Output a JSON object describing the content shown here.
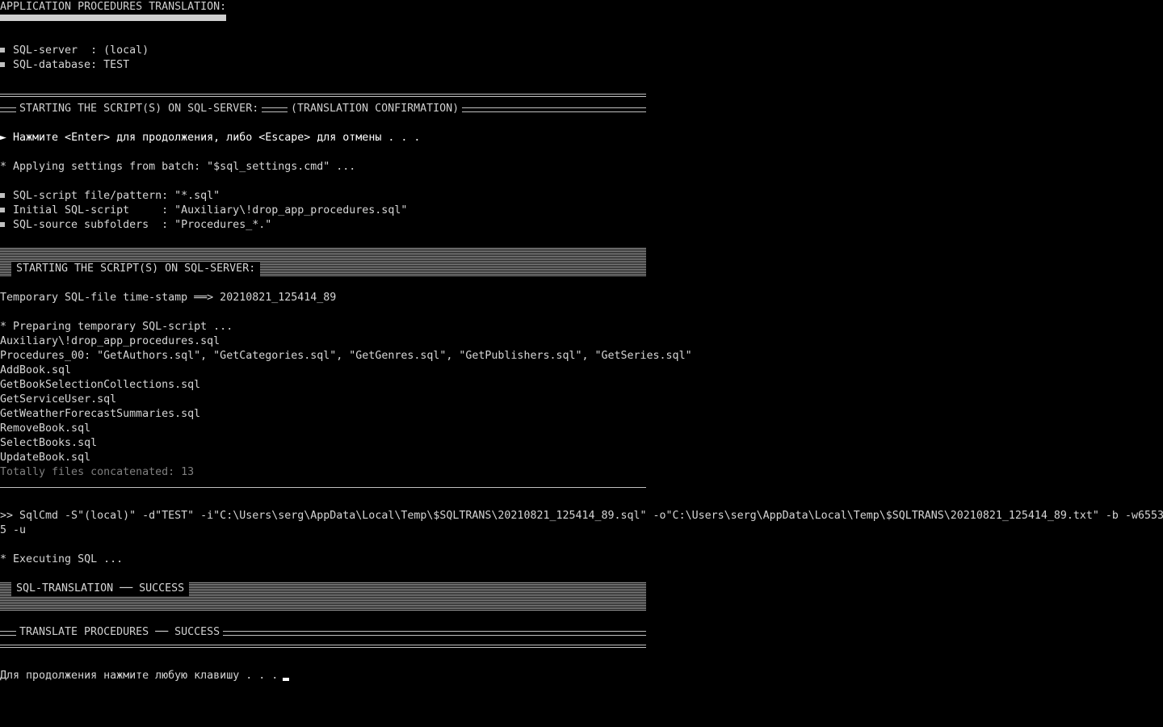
{
  "header": {
    "title": "APPLICATION PROCEDURES TRANSLATION:"
  },
  "server_info": {
    "server_line": "SQL-server  : (local)",
    "database_line": "SQL-database: TEST"
  },
  "confirm_banner": {
    "left": "STARTING THE SCRIPT(S) ON SQL-SERVER:",
    "right": "(TRANSLATION CONFIRMATION)"
  },
  "prompt": {
    "arrow": "►",
    "text": "Нажмите <Enter> для продолжения, либо <Escape> для отмены . . ."
  },
  "applying": "* Applying settings from batch: \"$sql_settings.cmd\" ...",
  "settings": {
    "pattern": "SQL-script file/pattern: \"*.sql\"",
    "initial": "Initial SQL-script     : \"Auxiliary\\!drop_app_procedures.sql\"",
    "subfolders": "SQL-source subfolders  : \"Procedures_*.\""
  },
  "run_banner": {
    "label": "STARTING THE SCRIPT(S) ON SQL-SERVER:"
  },
  "timestamp_line": "Temporary SQL-file time-stamp ══> 20210821_125414_89",
  "preparing": "* Preparing temporary SQL-script ...",
  "files": [
    "Auxiliary\\!drop_app_procedures.sql",
    "Procedures_00: \"GetAuthors.sql\", \"GetCategories.sql\", \"GetGenres.sql\", \"GetPublishers.sql\", \"GetSeries.sql\"",
    "AddBook.sql",
    "GetBookSelectionCollections.sql",
    "GetServiceUser.sql",
    "GetWeatherForecastSummaries.sql",
    "RemoveBook.sql",
    "SelectBooks.sql",
    "UpdateBook.sql"
  ],
  "total": "Totally files concatenated: 13",
  "command": {
    "line1": ">> SqlCmd -S\"(local)\" -d\"TEST\" -i\"C:\\Users\\serg\\AppData\\Local\\Temp\\$SQLTRANS\\20210821_125414_89.sql\" -o\"C:\\Users\\serg\\AppData\\Local\\Temp\\$SQLTRANS\\20210821_125414_89.txt\" -b -w6553",
    "line2": "5 -u"
  },
  "executing": "* Executing SQL ...",
  "translation_banner": {
    "label": "SQL-TRANSLATION ── SUCCESS"
  },
  "procedures_banner": {
    "label": "TRANSLATE PROCEDURES ── SUCCESS"
  },
  "footer": {
    "text": "Для продолжения нажмите любую клавишу . . ."
  }
}
